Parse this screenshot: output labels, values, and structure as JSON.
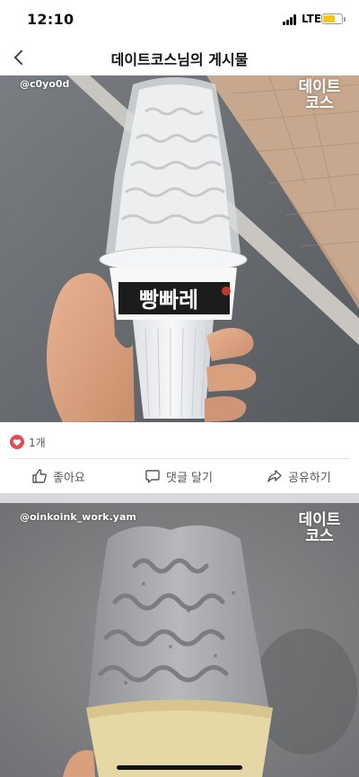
{
  "status_bar": {
    "time": "12:10",
    "network": "LTE",
    "battery_level": 0.6,
    "battery_color": "#f5c518"
  },
  "header": {
    "title": "데이트코스님의 게시물",
    "back_icon": "chevron-left-icon"
  },
  "posts": [
    {
      "watermark": "@c0yo0d",
      "brand_line1": "데이트",
      "brand_line2": "코스",
      "image_description_icon": "photo-image",
      "product_text": "빵빠레"
    },
    {
      "watermark": "@oinkoink_work.yam",
      "brand_line1": "데이트",
      "brand_line2": "코스",
      "image_description_icon": "photo-image"
    }
  ],
  "reactions": {
    "like_count": "1개",
    "heart_color": "#e8484f"
  },
  "actions": {
    "like": "좋아요",
    "comment": "댓글 달기",
    "share": "공유하기"
  }
}
